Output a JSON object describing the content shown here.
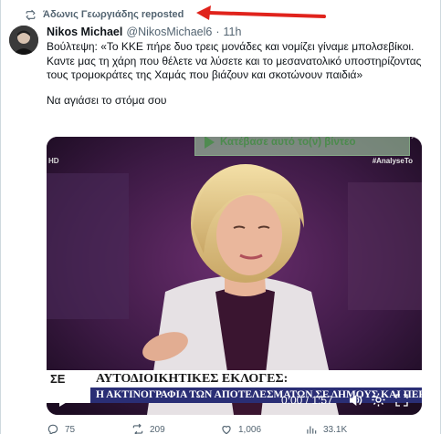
{
  "repost": {
    "label": "Άδωνις Γεωργιάδης reposted",
    "icon": "repost-icon"
  },
  "tweet": {
    "author_name": "Nikos Michael",
    "author_handle": "@NikosMichael6",
    "separator": "·",
    "time": "11h",
    "paragraph_1": "Βούλτεψη: «Το ΚΚΕ πήρε δυο τρεις μονάδες και νομίζει γίναμε μπολσεβίκοι. Καντε μας τη χάρη που θέλετε να λύσετε και το μεσανατολικό υποστηρίζοντας τους τρομοκράτες της Χαμάς που βιάζουν και σκοτώνουν παιδιά»",
    "paragraph_2": "Να αγιάσει το στόμα σου"
  },
  "video": {
    "download_banner": "Κατέβασε αυτό το(ν) βίντεο",
    "banner_close": "✕",
    "hashtag": "#AnalyseTo",
    "hd_label": "HD",
    "lower_third_logo": "ΣΕ",
    "lower_third_top": "ΑΥΤΟΔΙΟΙΚΗΤΙΚΕΣ ΕΚΛΟΓΕΣ:",
    "lower_third_bottom": "Η ΑΚΤΙΝΟΓΡΑΦΙΑ ΤΩΝ ΑΠΟΤΕΛΕΣΜΑΤΩΝ ΣΕ ΔΗΜΟΥΣ ΚΑΙ ΠΕΡΙΦΕΡΕΙΕΣ",
    "time": "0:00 / 1:57",
    "controls": [
      "play-icon",
      "volume-icon",
      "settings-gear-icon",
      "fullscreen-icon"
    ]
  },
  "actions": {
    "replies": "75",
    "reposts": "209",
    "likes": "1,006",
    "views": "33.1K"
  },
  "colors": {
    "annotation_arrow": "#e0231c",
    "muted_text": "#536471",
    "lower_third_blue": "#2a2e75"
  }
}
